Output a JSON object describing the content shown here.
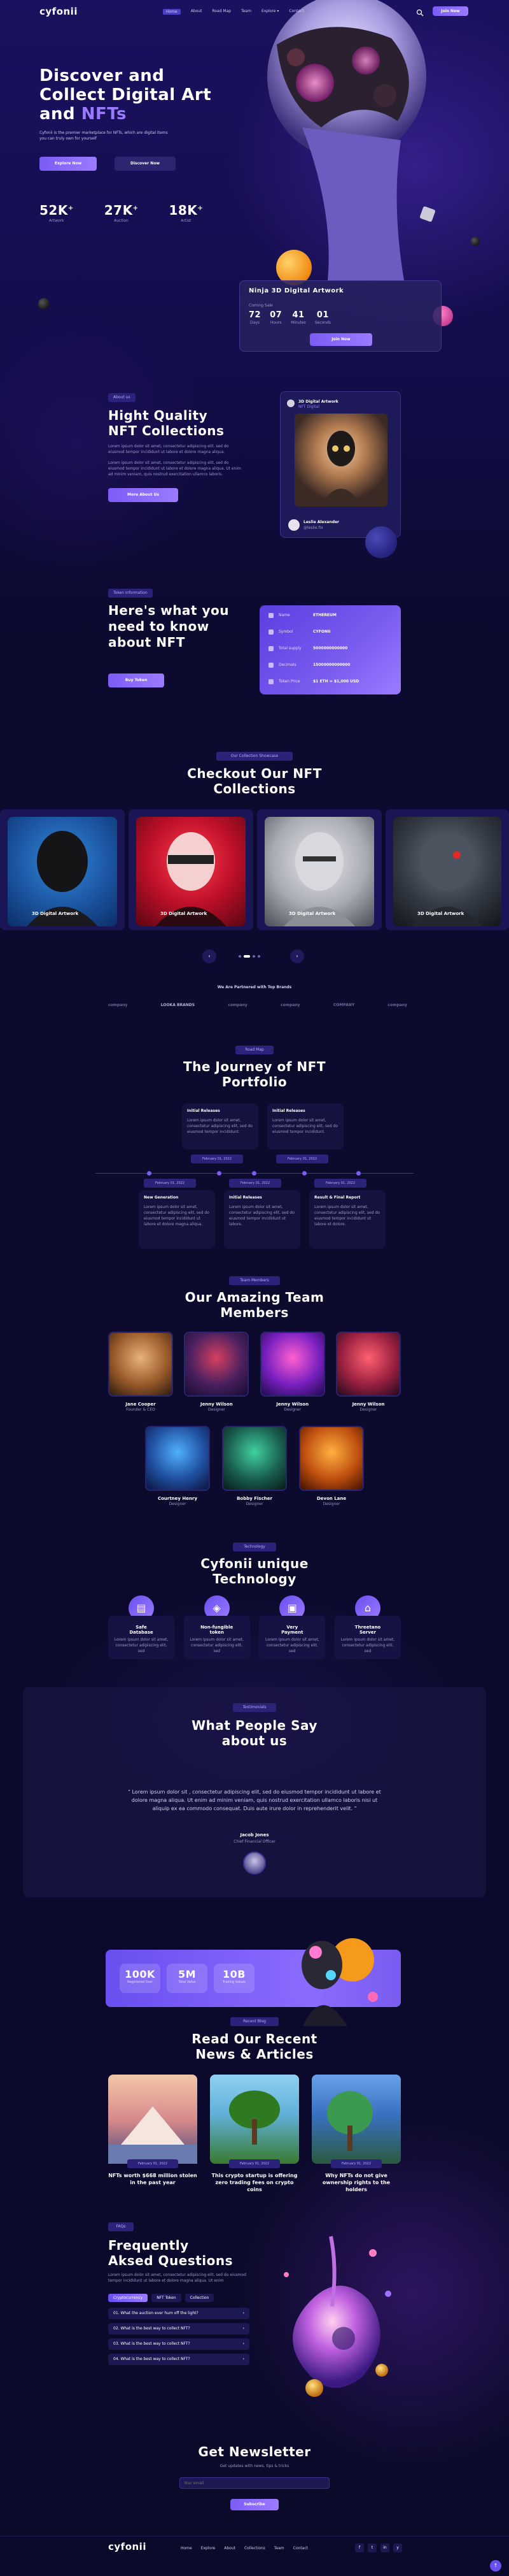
{
  "brand": "cyfonii",
  "nav": {
    "items": [
      "Home",
      "About",
      "Road Map",
      "Team",
      "Explore",
      "Contact"
    ],
    "cta": "Join Now"
  },
  "hero": {
    "title1": "Discover and",
    "title2": "Collect Digital Art",
    "title3": "and ",
    "title_accent": "NFTs",
    "desc": "Cyfonii is the premier marketplace for NFTs, which are digital items you can truly own for yourself",
    "btn1": "Explore Now",
    "btn2": "Discover Now",
    "stats": [
      {
        "value": "52K",
        "plus": "+",
        "label": "Artwork"
      },
      {
        "value": "27K",
        "plus": "+",
        "label": "Auction"
      },
      {
        "value": "18K",
        "plus": "+",
        "label": "Artist"
      }
    ],
    "card": {
      "title": "Ninja 3D Digital Artwork",
      "sub": "Coming Sale",
      "timer": [
        {
          "v": "72",
          "l": "Days"
        },
        {
          "v": "07",
          "l": "Hours"
        },
        {
          "v": "41",
          "l": "Minutes"
        },
        {
          "v": "01",
          "l": "Seconds"
        }
      ],
      "btn": "Join Now"
    }
  },
  "about": {
    "pill": "About us",
    "title1": "Hight Quality",
    "title2": "NFT Collections",
    "p1": "Lorem ipsum dolor sit amet, consectetur adipiscing elit. sed do eiusmod tempor incididunt ut labore et dolore magna aliqua.",
    "p2": "Lorem ipsum dolor sit amet, consectetur adipiscing elit, sed do eiusmod tempor incididunt ut labore et dolore magna aliqua. Ut enim ad minim veniam, quis nostrud exercitation ullamco laboris.",
    "btn": "More About Us",
    "card_title": "3D Digital Artwork",
    "card_sub": "NFT Digital",
    "creator": "Leslie Alexander",
    "creator_sub": "@leslie.fix"
  },
  "info": {
    "pill": "Token Information",
    "title1": "Here's what you",
    "title2": "need to know",
    "title3": "about NFT",
    "btn": "Buy Token",
    "rows": [
      {
        "k": "Name",
        "v": "ETHEREUM"
      },
      {
        "k": "Symbol",
        "v": "CYFONII"
      },
      {
        "k": "Total supply",
        "v": "5000000000000"
      },
      {
        "k": "Decimals",
        "v": "15000000000000"
      },
      {
        "k": "Token Price",
        "v": "$1 ETH = $1,000 USD"
      }
    ]
  },
  "collection": {
    "pill": "Our Collection Showcase",
    "title1": "Checkout Our NFT",
    "title2": "Collections",
    "items": [
      "3D Digital Artwork",
      "3D Digital Artwork",
      "3D Digital Artwork",
      "3D Digital Artwork"
    ]
  },
  "partners": {
    "title": "We Are Partnered with Top Brands",
    "logos": [
      "company",
      "LOOKA BRANDS",
      "company",
      "company",
      "COMPANY",
      "company"
    ]
  },
  "roadmap": {
    "pill": "Road Map",
    "title1": "The Journey of NFT",
    "title2": "Portfolio",
    "top": [
      {
        "t": "Initial Releases",
        "d": "Lorem ipsum dolor sit amet, consectetur adipiscing elit, sed do eiusmod tempor incididunt.",
        "date": "February 01, 2022"
      },
      {
        "t": "Initial Releases",
        "d": "Lorem ipsum dolor sit amet, consectetur adipiscing elit, sed do eiusmod tempor incididunt.",
        "date": "February 01, 2022"
      }
    ],
    "bottom": [
      {
        "t": "New Generation",
        "d": "Lorem ipsum dolor sit amet, consectetur adipiscing elit, sed do eiusmod tempor incididunt ut labore et dolore magna aliqua.",
        "date": "February 01, 2022"
      },
      {
        "t": "Initial Releases",
        "d": "Lorem ipsum dolor sit amet, consectetur adipiscing elit, sed do eiusmod tempor incididunt ut labore.",
        "date": "February 01, 2022"
      },
      {
        "t": "Result & Final Report",
        "d": "Lorem ipsum dolor sit amet, consectetur adipiscing elit, sed do eiusmod tempor incididunt ut labore et dolore.",
        "date": "February 01, 2022"
      }
    ]
  },
  "team": {
    "pill": "Team Members",
    "title1": "Our Amazing Team",
    "title2": "Members",
    "row1": [
      {
        "n": "Jane Cooper",
        "r": "Founder & CEO"
      },
      {
        "n": "Jenny Wilson",
        "r": "Designer"
      },
      {
        "n": "Jenny Wilson",
        "r": "Designer"
      },
      {
        "n": "Jenny Wilson",
        "r": "Designer"
      }
    ],
    "row2": [
      {
        "n": "Courtney Henry",
        "r": "Designer"
      },
      {
        "n": "Bobby Fischer",
        "r": "Designer"
      },
      {
        "n": "Devon Lane",
        "r": "Designer"
      }
    ]
  },
  "tech": {
    "pill": "Technology",
    "title1": "Cyfonii unique",
    "title2": "Technology",
    "items": [
      {
        "t": "Safe",
        "t2": "Database",
        "d": "Lorem ipsum dolor sit amet, consectetur adipiscing elit, sed"
      },
      {
        "t": "Non-fungible",
        "t2": "token",
        "d": "Lorem ipsum dolor sit amet, consectetur adipiscing elit, sed"
      },
      {
        "t": "Very",
        "t2": "Payment",
        "d": "Lorem ipsum dolor sit amet, consectetur adipiscing elit, sed"
      },
      {
        "t": "Threetano",
        "t2": "Server",
        "d": "Lorem ipsum dolor sit amet, consectetur adipiscing elit, sed"
      }
    ]
  },
  "testimonial": {
    "pill": "Testimonials",
    "title1": "What People Say",
    "title2": "about us",
    "quote": "\" Lorem ipsum dolor sit , consectetur adipiscing elit, sed do eiusmod tempor incididunt ut labore et dolore magna aliqua. Ut enim ad minim veniam, quis nostrud exercitation ullamco laboris nisi ut aliquip ex ea commodo consequat. Duis aute irure dolor in reprehenderit velit. \"",
    "name": "Jacob Jones",
    "role": "Chief Financial Officer"
  },
  "counters": [
    {
      "v": "100K",
      "l": "Registered User"
    },
    {
      "v": "5M",
      "l": "Total Value"
    },
    {
      "v": "10B",
      "l": "Trading Values"
    }
  ],
  "blog": {
    "pill": "Recent Blog",
    "title1": "Read Our Recent",
    "title2": "News & Articles",
    "posts": [
      {
        "date": "February 01, 2022",
        "t": "NFTs worth $668 million stolen in the past year"
      },
      {
        "date": "February 01, 2022",
        "t": "This crypto startup is offering zero trading fees on crypto coins"
      },
      {
        "date": "February 01, 2022",
        "t": "Why NFTs do not give ownership rights to the holders"
      }
    ]
  },
  "faq": {
    "pill": "FAQs",
    "title1": "Frequently",
    "title2": "Aksed Questions",
    "desc": "Lorem ipsum dolor sit amet, consectetur adipiscing elit, sed do eiusmod tempor incididunt ut labore et dolore magna aliqua. Ut enim",
    "tabs": [
      "Cryptocurrency",
      "NFT Token",
      "Collection"
    ],
    "items": [
      "01. What the auction ever hum off the light?",
      "02. What is the best way to collect NFT?",
      "03. What is the best way to collect NFT?",
      "04. What is the best way to collect NFT?"
    ]
  },
  "newsletter": {
    "title": "Get Newsletter",
    "desc": "Get updates with news, tips & tricks",
    "placeholder": "Your email",
    "btn": "Subscribe"
  },
  "footer": {
    "links": [
      "Home",
      "Explore",
      "About",
      "Collections",
      "Team",
      "Contact"
    ],
    "socials": [
      "f",
      "t",
      "in",
      "y"
    ]
  }
}
